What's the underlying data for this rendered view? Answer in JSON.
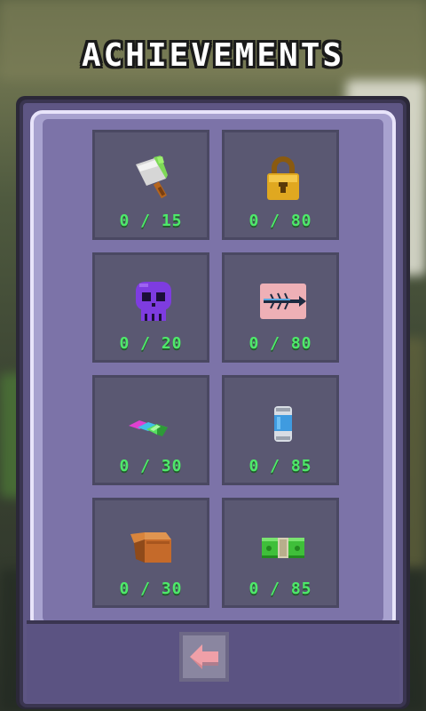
{
  "screen": {
    "title": "ACHIEVEMENTS"
  },
  "achievements": [
    {
      "icon": "cleaver-icon",
      "progress": "0 / 15"
    },
    {
      "icon": "padlock-icon",
      "progress": "0 / 80"
    },
    {
      "icon": "purple-skull-icon",
      "progress": "0 / 20"
    },
    {
      "icon": "fish-bone-icon",
      "progress": "0 / 80"
    },
    {
      "icon": "gems-icon",
      "progress": "0 / 30"
    },
    {
      "icon": "soda-can-icon",
      "progress": "0 / 85"
    },
    {
      "icon": "cardboard-box-icon",
      "progress": "0 / 30"
    },
    {
      "icon": "cash-stack-icon",
      "progress": "0 / 85"
    }
  ],
  "navigation": {
    "back_icon": "left-arrow-icon"
  },
  "colors": {
    "progress_text": "#4ee96a",
    "panel": "#7c73a8",
    "card": "#5a5872"
  }
}
